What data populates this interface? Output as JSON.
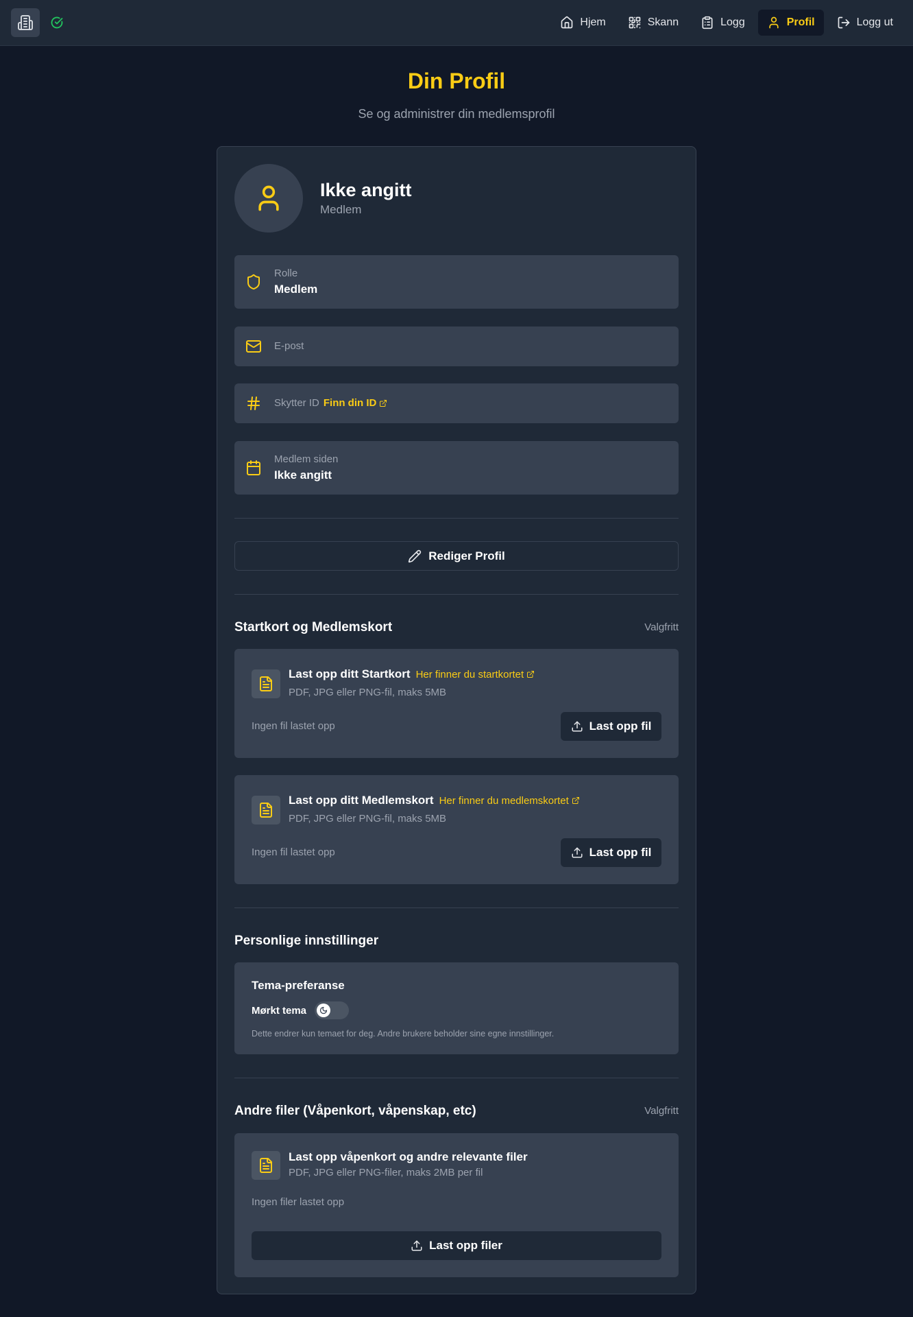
{
  "nav": {
    "items": [
      {
        "label": "Hjem",
        "icon": "home-icon"
      },
      {
        "label": "Skann",
        "icon": "qr-scan-icon"
      },
      {
        "label": "Logg",
        "icon": "clipboard-icon"
      },
      {
        "label": "Profil",
        "icon": "user-icon",
        "active": true
      },
      {
        "label": "Logg ut",
        "icon": "logout-icon"
      }
    ]
  },
  "header": {
    "title": "Din Profil",
    "subtitle": "Se og administrer din medlemsprofil"
  },
  "profile": {
    "name": "Ikke angitt",
    "role_caption": "Medlem"
  },
  "fields": {
    "role": {
      "label": "Rolle",
      "value": "Medlem"
    },
    "email": {
      "label": "E-post"
    },
    "shooter_id": {
      "label": "Skytter ID",
      "link": "Finn din ID"
    },
    "member_since": {
      "label": "Medlem siden",
      "value": "Ikke angitt"
    }
  },
  "edit_button": "Rediger Profil",
  "cards_section": {
    "title": "Startkort og Medlemskort",
    "optional": "Valgfritt",
    "start_card": {
      "title": "Last opp ditt Startkort",
      "link": "Her finner du startkortet",
      "subtitle": "PDF, JPG eller PNG-fil, maks 5MB",
      "status": "Ingen fil lastet opp",
      "button": "Last opp fil"
    },
    "member_card": {
      "title": "Last opp ditt Medlemskort",
      "link": "Her finner du medlemskortet",
      "subtitle": "PDF, JPG eller PNG-fil, maks 5MB",
      "status": "Ingen fil lastet opp",
      "button": "Last opp fil"
    }
  },
  "settings": {
    "title": "Personlige innstillinger",
    "theme_title": "Tema-preferanse",
    "dark_label": "Mørkt tema",
    "note": "Dette endrer kun temaet for deg. Andre brukere beholder sine egne innstillinger."
  },
  "other_files": {
    "title": "Andre filer (Våpenkort, våpenskap, etc)",
    "optional": "Valgfritt",
    "upload_title": "Last opp våpenkort og andre relevante filer",
    "subtitle": "PDF, JPG eller PNG-filer, maks 2MB per fil",
    "status": "Ingen filer lastet opp",
    "button": "Last opp filer"
  },
  "colors": {
    "accent": "#facc15",
    "background": "#111827",
    "surface": "#1f2937",
    "field": "#374151",
    "success": "#22c55e"
  }
}
